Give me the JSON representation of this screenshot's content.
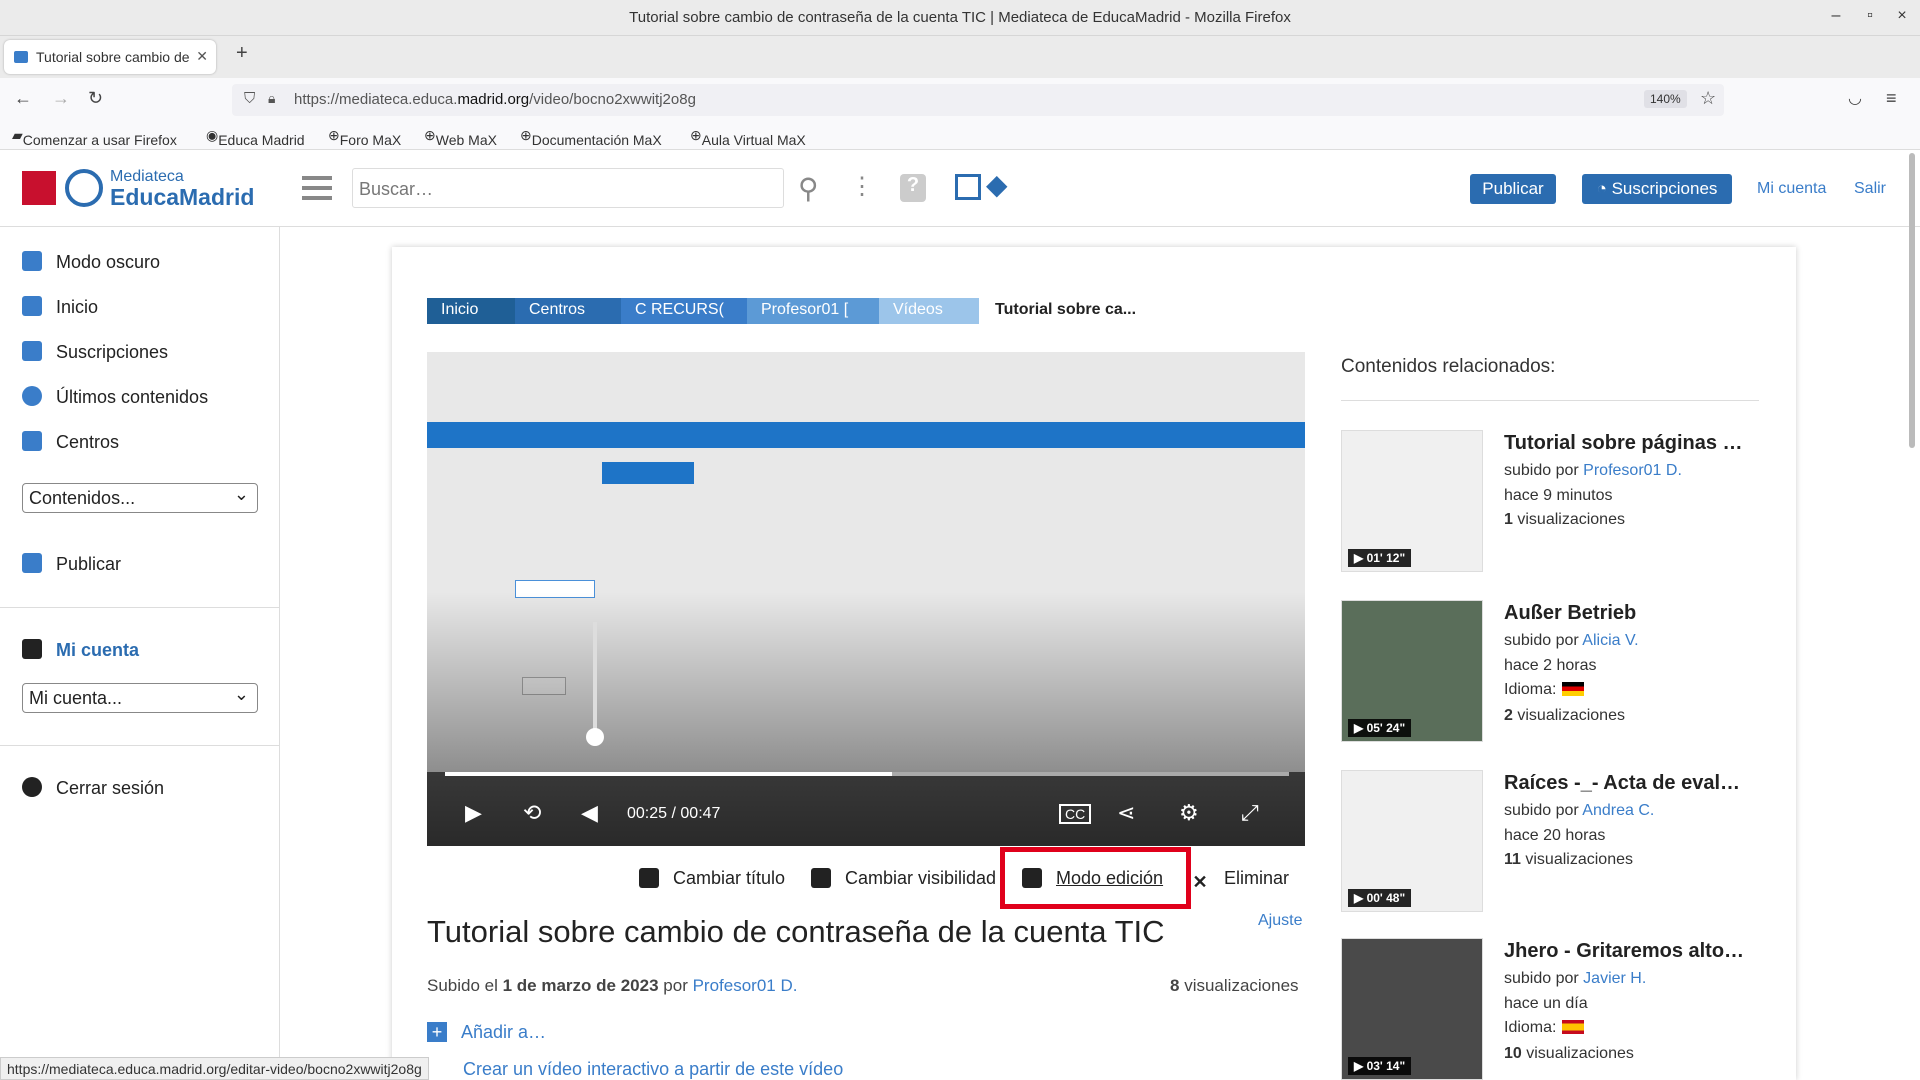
{
  "window": {
    "title": "Tutorial sobre cambio de contraseña de la cuenta TIC | Mediateca de EducaMadrid - Mozilla Firefox"
  },
  "tab": {
    "label": "Tutorial sobre cambio de"
  },
  "url": {
    "prefix": "https://mediateca.educa.",
    "domain": "madrid.org",
    "path": "/video/bocno2xwwitj2o8g",
    "zoom": "140%"
  },
  "bookmarks": [
    "Comenzar a usar Firefox",
    "Educa Madrid",
    "Foro MaX",
    "Web MaX",
    "Documentación MaX",
    "Aula Virtual MaX"
  ],
  "header": {
    "logo_top": "Mediateca",
    "logo_bottom": "EducaMadrid",
    "search_placeholder": "Buscar…",
    "publicar": "Publicar",
    "suscripciones": "Suscripciones",
    "mi_cuenta": "Mi cuenta",
    "salir": "Salir"
  },
  "sidebar": {
    "items": [
      "Modo oscuro",
      "Inicio",
      "Suscripciones",
      "Últimos contenidos",
      "Centros"
    ],
    "contenidos_select": "Contenidos...",
    "publicar": "Publicar",
    "mi_cuenta_heading": "Mi cuenta",
    "mi_cuenta_select": "Mi cuenta...",
    "cerrar": "Cerrar sesión"
  },
  "breadcrumb": [
    "Inicio",
    "Centros",
    "C RECURS(",
    "Profesor01 [",
    "Vídeos",
    "Tutorial sobre ca..."
  ],
  "video": {
    "current": "00:25",
    "separator": "/",
    "duration": "00:47",
    "progress": 0.53
  },
  "actions": {
    "cambiar_titulo": "Cambiar título",
    "cambiar_visibilidad": "Cambiar visibilidad",
    "modo_edicion": "Modo edición",
    "eliminar": "Eliminar"
  },
  "main": {
    "ajuste": "Ajuste",
    "title": "Tutorial sobre cambio de contraseña de la cuenta TIC",
    "subido_el": "Subido el",
    "date": "1 de marzo de 2023",
    "por": "por",
    "author": "Profesor01 D.",
    "views_count": "8",
    "views_label": "visualizaciones",
    "add": "Añadir a…",
    "interactive": "Crear un vídeo interactivo a partir de este vídeo"
  },
  "related": {
    "heading": "Contenidos relacionados:",
    "items": [
      {
        "title": "Tutorial sobre páginas …",
        "by": "subido por",
        "author": "Profesor01 D.",
        "time": "hace 9 minutos",
        "views": "1",
        "views_label": "visualizaciones",
        "duration": "01' 12\""
      },
      {
        "title": "Außer Betrieb",
        "by": "subido por",
        "author": "Alicia V.",
        "time": "hace 2 horas",
        "idioma": "Idioma:",
        "views": "2",
        "views_label": "visualizaciones",
        "duration": "05' 24\""
      },
      {
        "title": "Raíces -_- Acta de eval…",
        "by": "subido por",
        "author": "Andrea C.",
        "time": "hace 20 horas",
        "views": "11",
        "views_label": "visualizaciones",
        "duration": "00' 48\""
      },
      {
        "title": "Jhero - Gritaremos alto…",
        "by": "subido por",
        "author": "Javier H.",
        "time": "hace un día",
        "idioma": "Idioma:",
        "views": "10",
        "views_label": "visualizaciones",
        "duration": "03' 14\""
      }
    ]
  },
  "statusbar": "https://mediateca.educa.madrid.org/editar-video/bocno2xwwitj2o8g",
  "colors": {
    "brand": "#2b6cb0",
    "highlight": "#e0001b",
    "crumb_dark": "#1f5f96",
    "crumb_mid": "#3a7dc9",
    "crumb_light": "#7fb3e0"
  }
}
